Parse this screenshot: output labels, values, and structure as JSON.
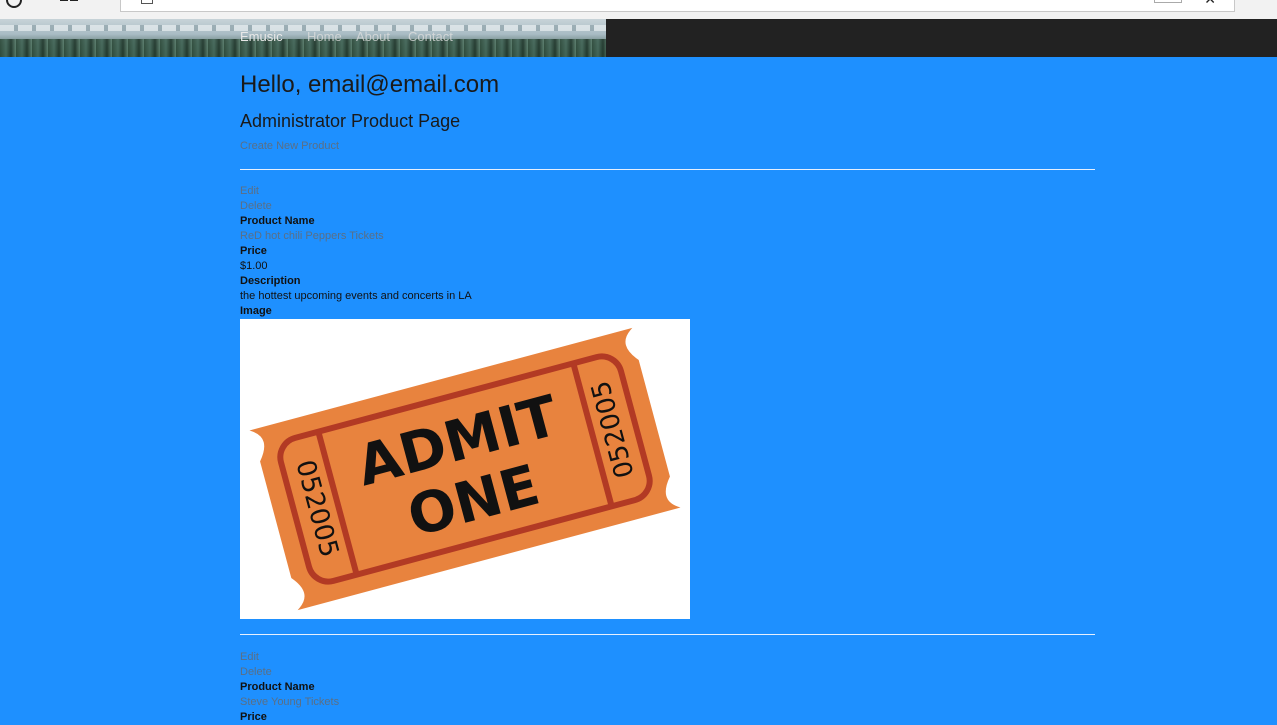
{
  "navbar": {
    "brand": "Emusic",
    "links": [
      "Home",
      "About",
      "Contact"
    ]
  },
  "greeting": "Hello, email@email.com",
  "page_title": "Administrator Product Page",
  "create_link": "Create New Product",
  "labels": {
    "edit": "Edit",
    "delete": "Delete",
    "product_name": "Product Name",
    "price": "Price",
    "description": "Description",
    "image": "Image"
  },
  "products": [
    {
      "name": "ReD hot chili Peppers Tickets",
      "price": "$1.00",
      "description": "the hottest upcoming events and concerts in LA",
      "ticket": {
        "line1": "ADMIT",
        "line2": "ONE",
        "serial": "052005"
      }
    },
    {
      "name": "Steve Young Tickets"
    }
  ],
  "colors": {
    "page_background": "#1e90ff",
    "navbar_background": "#222222",
    "ticket_orange": "#e8833e",
    "ticket_border": "#b23a24"
  }
}
